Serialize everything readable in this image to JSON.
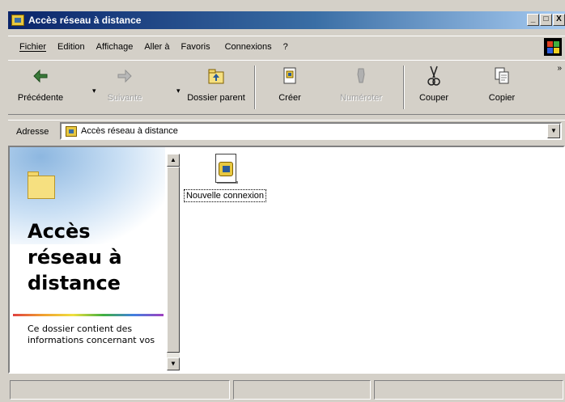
{
  "window": {
    "title": "Accès réseau à distance",
    "controls": [
      "_",
      "□",
      "X"
    ]
  },
  "menu": {
    "items": [
      "Fichier",
      "Edition",
      "Affichage",
      "Aller à",
      "Favoris",
      "Connexions",
      "?"
    ]
  },
  "toolbar": {
    "buttons": [
      {
        "label": "Précédente",
        "icon": "back-arrow-icon",
        "enabled": true
      },
      {
        "label": "Suivante",
        "icon": "forward-arrow-icon",
        "enabled": false
      },
      {
        "label": "Dossier parent",
        "icon": "up-folder-icon",
        "enabled": true
      },
      {
        "label": "Créer",
        "icon": "create-icon",
        "enabled": true
      },
      {
        "label": "Numéroter",
        "icon": "dial-icon",
        "enabled": false
      },
      {
        "label": "Couper",
        "icon": "scissors-icon",
        "enabled": true
      },
      {
        "label": "Copier",
        "icon": "copy-icon",
        "enabled": true
      }
    ]
  },
  "address": {
    "label": "Adresse",
    "value": "Accès réseau à distance"
  },
  "left_pane": {
    "title": "Accès réseau à distance",
    "description": "Ce dossier contient des informations concernant vos"
  },
  "files": [
    {
      "label": "Nouvelle connexion",
      "icon": "new-connection-icon",
      "selected": true
    }
  ],
  "colors": {
    "titlebar_start": "#0a246a",
    "titlebar_end": "#a6caf0",
    "chrome": "#d4d0c8"
  }
}
